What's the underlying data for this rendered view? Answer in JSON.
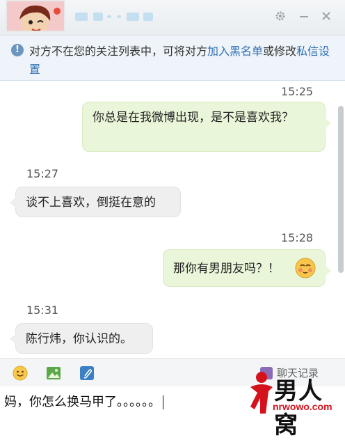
{
  "window": {
    "settings_icon": "gear-icon",
    "minimize_icon": "minimize-icon",
    "close_icon": "close-icon"
  },
  "notice": {
    "icon": "info-icon",
    "text_before": "对方不在您的关注列表中，可将对方",
    "link_blacklist": "加入黑名单",
    "text_middle": "或修改",
    "link_settings": "私信设置"
  },
  "messages": [
    {
      "side": "right",
      "time": "15:25",
      "text": "你总是在我微博出现，是不是喜欢我？"
    },
    {
      "side": "left",
      "time": "15:27",
      "text": "谈不上喜欢，倒挺在意的"
    },
    {
      "side": "right",
      "time": "15:28",
      "text": "那你有男朋友吗？！"
    },
    {
      "side": "left",
      "time": "15:31",
      "text": "陈行炜，你认识的。"
    }
  ],
  "toolbar": {
    "emoji_icon": "smiley-icon",
    "image_icon": "image-icon",
    "attach_icon": "paperclip-icon",
    "history_label": "聊天记录"
  },
  "input": {
    "value": "妈，你怎么换马甲了。。。。。。"
  },
  "watermark": {
    "brand": "男人窝",
    "url": "nrwowo.com"
  },
  "colors": {
    "accent_link": "#2e6fb7",
    "bubble_right": "#eaf6d9",
    "bubble_left": "#efefef",
    "watermark_red": "#d4121c"
  }
}
